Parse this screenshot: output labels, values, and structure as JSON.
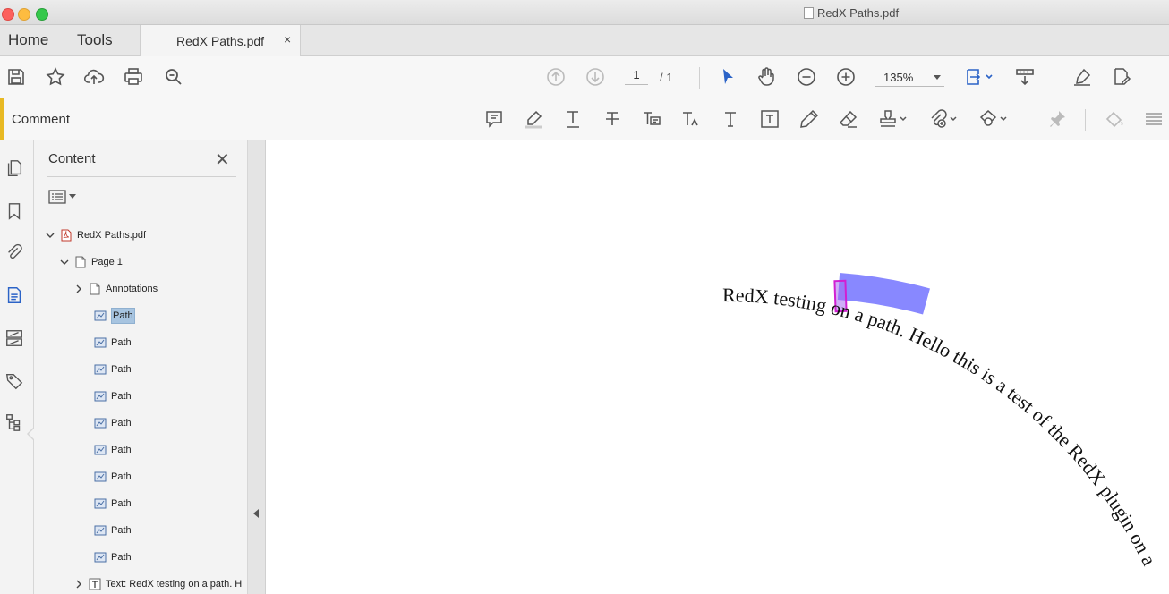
{
  "window": {
    "title": "RedX Paths.pdf"
  },
  "tabs": {
    "home": "Home",
    "tools": "Tools",
    "document": "RedX Paths.pdf",
    "close_glyph": "×"
  },
  "toolbar": {
    "page_current": "1",
    "page_total": "/ 1",
    "zoom": "135%"
  },
  "comment_bar": {
    "label": "Comment"
  },
  "content_panel": {
    "title": "Content",
    "close_glyph": "✕",
    "tree": {
      "root": "RedX Paths.pdf",
      "page": "Page 1",
      "annotations": "Annotations",
      "paths": [
        "Path",
        "Path",
        "Path",
        "Path",
        "Path",
        "Path",
        "Path",
        "Path",
        "Path",
        "Path"
      ],
      "text_node": "Text: RedX testing on a path. H"
    }
  },
  "document": {
    "path_text": "RedX testing on a path. Hello this is a test of the RedX plugin on a"
  },
  "colors": {
    "accent_comment": "#e8b923",
    "selection_highlight": "#7b7bff",
    "caret_box": "#d21fd2",
    "select_tool_blue": "#2b63c7"
  }
}
